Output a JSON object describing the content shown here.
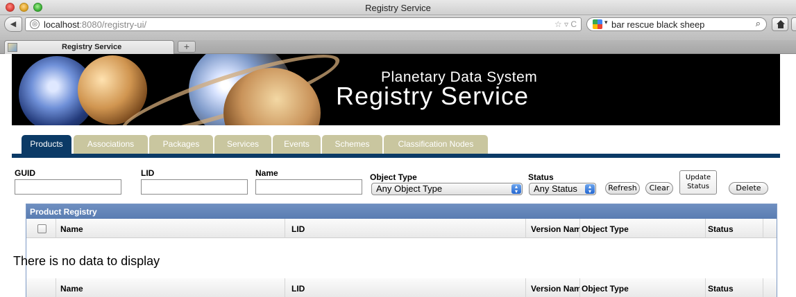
{
  "window": {
    "title": "Registry Service"
  },
  "toolbar": {
    "url_host": "localhost",
    "url_rest": ":8080/registry-ui/",
    "search_text": "bar rescue black sheep"
  },
  "browser_tab": {
    "label": "Registry Service",
    "new_tab_symbol": "+"
  },
  "banner": {
    "subtitle": "Planetary Data System",
    "title": "Registry Service"
  },
  "app_tabs": [
    {
      "label": "Products",
      "active": true
    },
    {
      "label": "Associations",
      "active": false
    },
    {
      "label": "Packages",
      "active": false
    },
    {
      "label": "Services",
      "active": false
    },
    {
      "label": "Events",
      "active": false
    },
    {
      "label": "Schemes",
      "active": false
    },
    {
      "label": "Classification Nodes",
      "active": false
    }
  ],
  "filters": {
    "guid_label": "GUID",
    "lid_label": "LID",
    "name_label": "Name",
    "object_type_label": "Object Type",
    "object_type_value": "Any Object Type",
    "status_label": "Status",
    "status_value": "Any Status",
    "refresh_label": "Refresh",
    "clear_label": "Clear",
    "update_status_label_1": "Update",
    "update_status_label_2": "Status",
    "delete_label": "Delete"
  },
  "grid": {
    "title": "Product Registry",
    "columns": [
      "Name",
      "LID",
      "Version Name",
      "Object Type",
      "Status"
    ],
    "empty_message": "There is no data to display"
  },
  "colors": {
    "active_tab": "#0b3a66",
    "inactive_tab": "#c9c69f",
    "grid_header": "#5a7db2"
  }
}
